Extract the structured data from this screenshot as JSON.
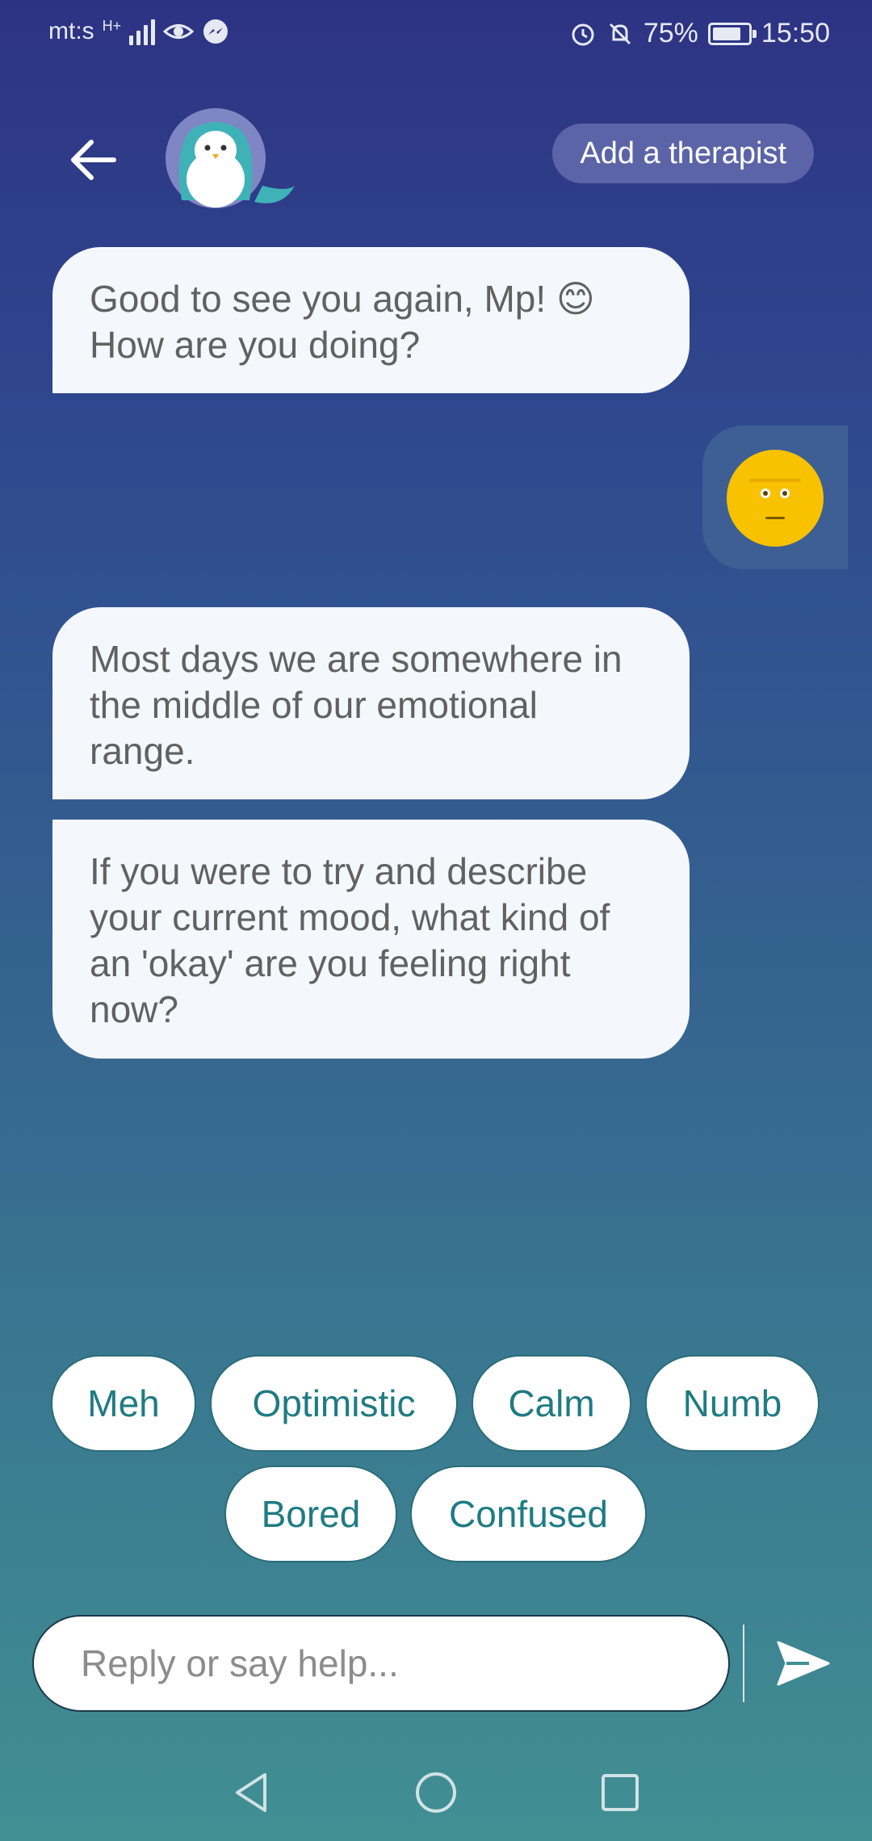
{
  "status_bar": {
    "carrier": "mt:s",
    "network": "H+",
    "battery": "75%",
    "time": "15:50"
  },
  "header": {
    "add_therapist_label": "Add a therapist"
  },
  "chat": {
    "messages": [
      "Good to see you again, Mp! 😊 How are you doing?",
      "Most days we are somewhere in the middle of our emotional range.",
      "If you were to try and describe your current mood, what kind of an 'okay' are you feeling right now?"
    ]
  },
  "quick_replies": [
    "Meh",
    "Optimistic",
    "Calm",
    "Numb",
    "Bored",
    "Confused"
  ],
  "composer": {
    "placeholder": "Reply or say help..."
  },
  "colors": {
    "bubble_bg": "#f4f7fc",
    "chip_text": "#1f7b82",
    "mood_face": "#f8c200"
  }
}
